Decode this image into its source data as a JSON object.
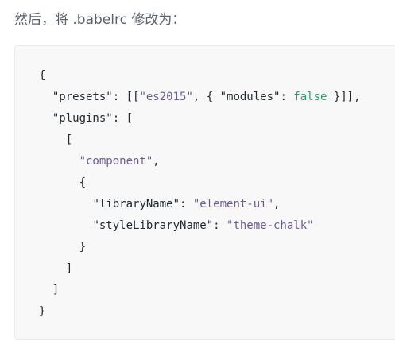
{
  "intro_text": "然后，将 .babelrc 修改为：",
  "code": {
    "open_brace": "{",
    "presets_key": "\"presets\"",
    "presets_mid": ": [[",
    "es2015": "\"es2015\"",
    "presets_mid2": ", { ",
    "modules_key": "\"modules\"",
    "colon": ": ",
    "false_kw": "false",
    "presets_end": " }]],",
    "plugins_key": "\"plugins\"",
    "plugins_mid": ": [",
    "open_bracket": "[",
    "component": "\"component\"",
    "comma": ",",
    "inner_open_brace": "{",
    "libraryName_key": "\"libraryName\"",
    "element_ui": "\"element-ui\"",
    "styleLibraryName_key": "\"styleLibraryName\"",
    "theme_chalk": "\"theme-chalk\"",
    "inner_close_brace": "}",
    "close_bracket": "]",
    "outer_close_bracket": "]",
    "close_brace": "}"
  }
}
